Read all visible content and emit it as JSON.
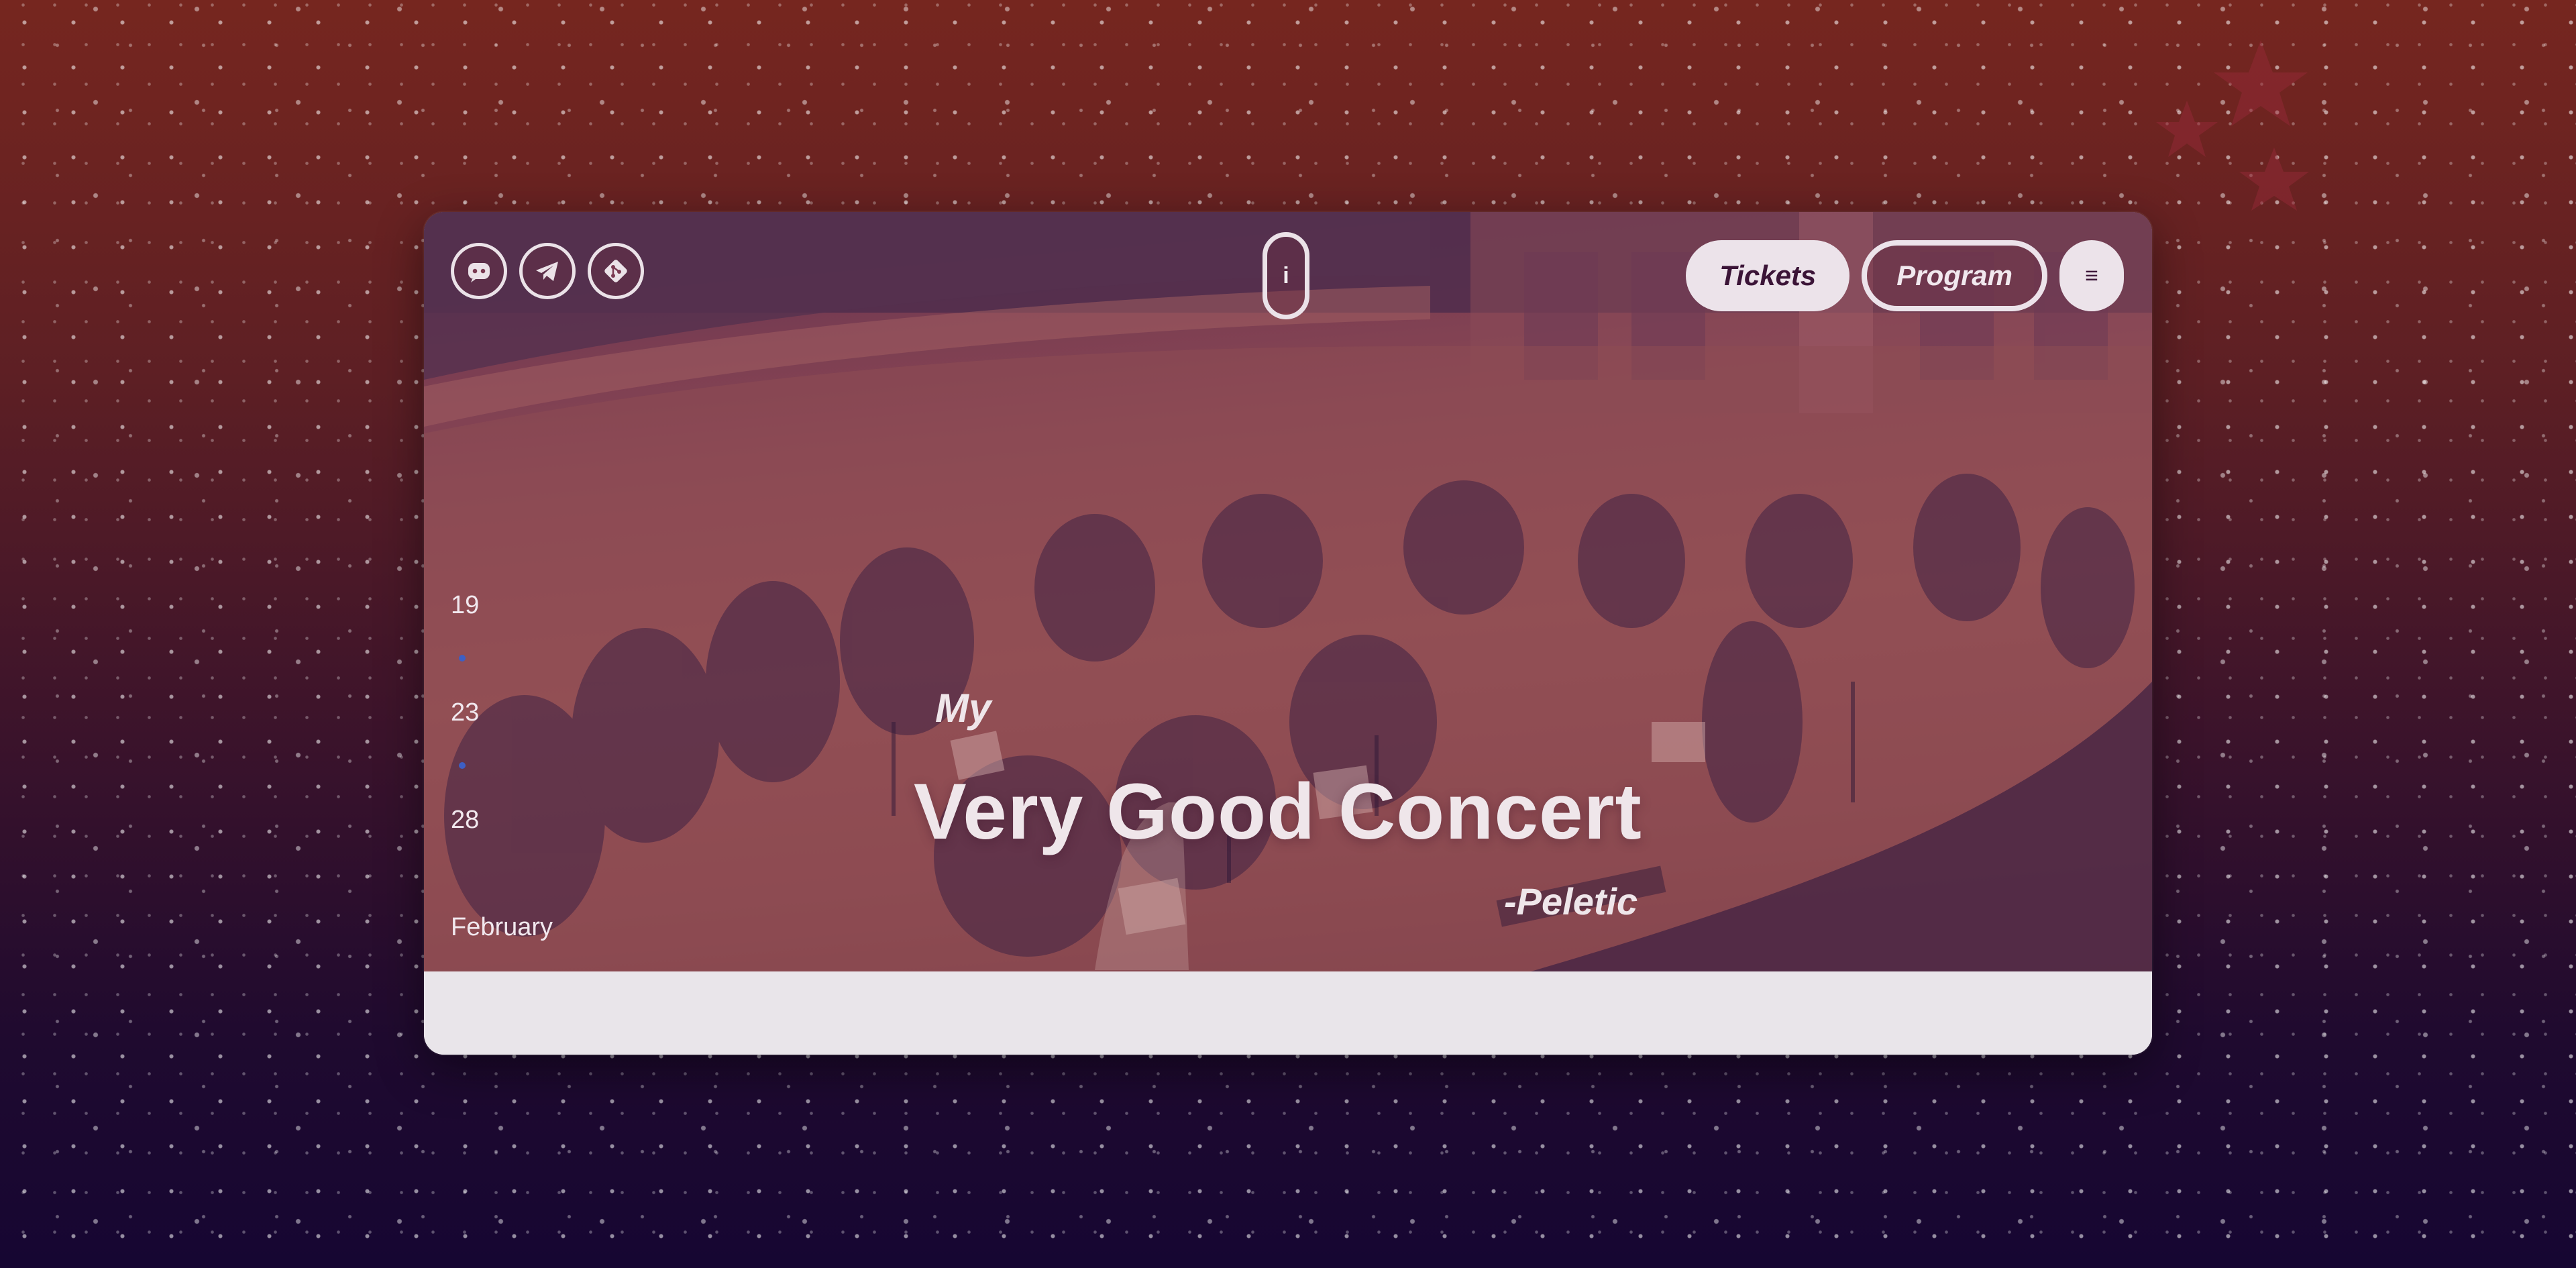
{
  "socials": [
    {
      "icon": "discord-icon",
      "label": "Discord"
    },
    {
      "icon": "telegram-icon",
      "label": "Telegram"
    },
    {
      "icon": "git-icon",
      "label": "Git"
    }
  ],
  "info_button": {
    "label": "i"
  },
  "nav": {
    "tickets": "Tickets",
    "program": "Program",
    "menu_icon": "≡"
  },
  "timeline": {
    "items": [
      "19",
      "23",
      "28",
      "February"
    ]
  },
  "hero": {
    "overline": "My",
    "title": "Very Good Concert",
    "author": "-Peletic"
  },
  "colors": {
    "background_top": "#76261f",
    "background_bottom": "#160632",
    "hero_tint": "#8d4a55",
    "button_light": "#ece3ea",
    "button_text": "#3b1437",
    "timeline_dot": "#3d5fc4"
  }
}
